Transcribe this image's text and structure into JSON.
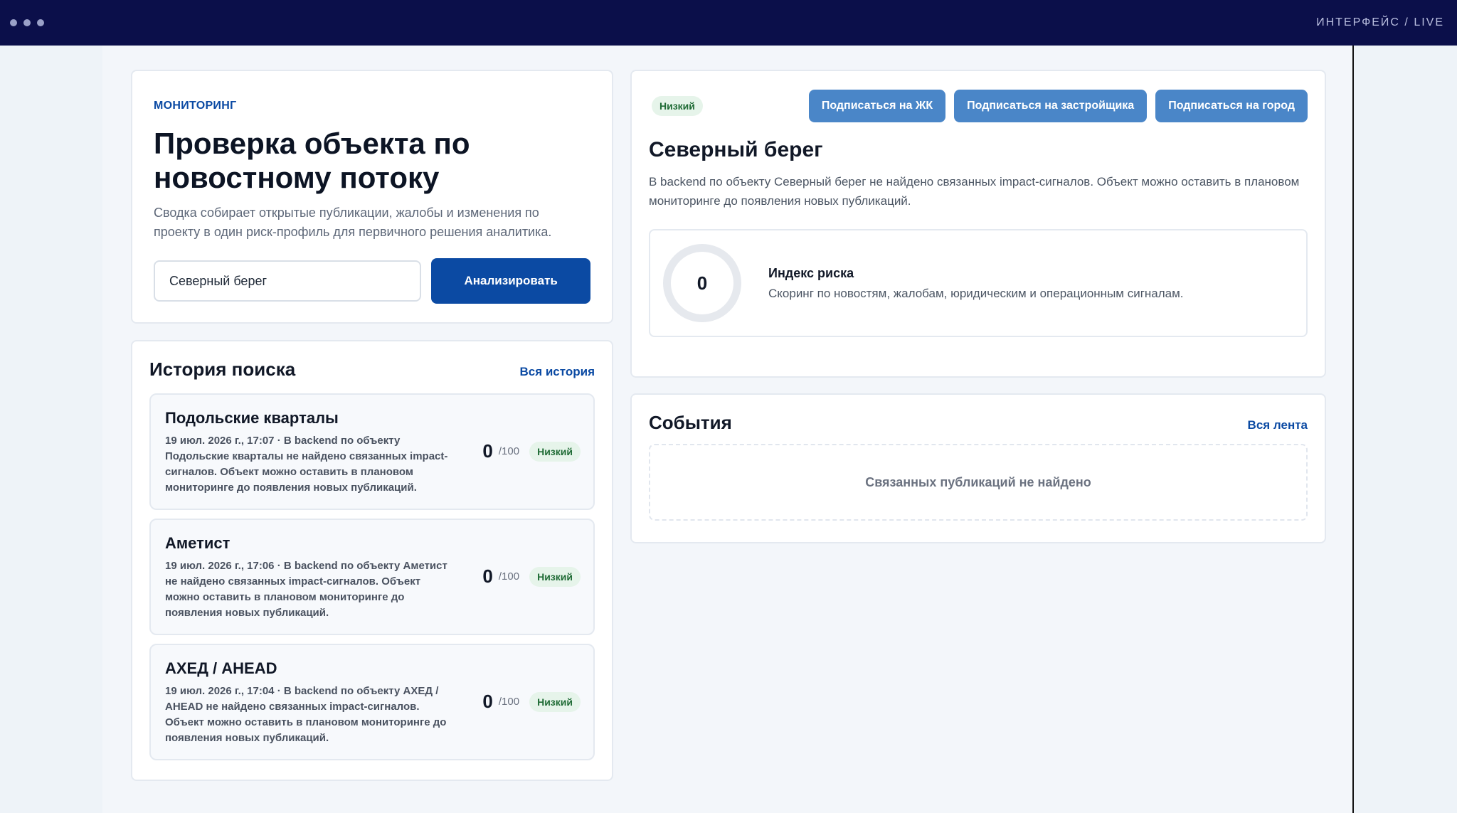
{
  "window": {
    "brand": "ИНТЕРФЕЙС / LIVE"
  },
  "monitor": {
    "kicker": "МОНИТОРИНГ",
    "title": "Проверка объекта по новостному потоку",
    "lead": "Сводка собирает открытые публикации, жалобы и изменения по проекту в один риск-профиль для первичного решения аналитика.",
    "search_value": "Северный берег",
    "analyze_label": "Анализировать"
  },
  "history": {
    "title": "История поиска",
    "all_link": "Вся история",
    "items": [
      {
        "title": "Подольские кварталы",
        "desc": "19 июл. 2026 г., 17:07 · В backend по объекту Подольские кварталы не найдено связанных impact-сигналов. Объект можно оставить в плановом мониторинге до появления новых публикаций.",
        "score": "0",
        "of": "/100",
        "badge": "Низкий"
      },
      {
        "title": "Аметист",
        "desc": "19 июл. 2026 г., 17:06 · В backend по объекту Аметист не найдено связанных impact-сигналов. Объект можно оставить в плановом мониторинге до появления новых публикаций.",
        "score": "0",
        "of": "/100",
        "badge": "Низкий"
      },
      {
        "title": "АХЕД / AHEAD",
        "desc": "19 июл. 2026 г., 17:04 · В backend по объекту АХЕД / AHEAD не найдено связанных impact-сигналов. Объект можно оставить в плановом мониторинге до появления новых публикаций.",
        "score": "0",
        "of": "/100",
        "badge": "Низкий"
      }
    ]
  },
  "object": {
    "badge": "Низкий",
    "subscribe_complex": "Подписаться на ЖК",
    "subscribe_developer": "Подписаться на застройщика",
    "subscribe_city": "Подписаться на город",
    "title": "Северный берег",
    "desc": "В backend по объекту Северный берег не найдено связанных impact-сигналов. Объект можно оставить в плановом мониторинге до появления новых публикаций.",
    "risk_value": "0",
    "risk_label": "Индекс риска",
    "risk_sub": "Скоринг по новостям, жалобам, юридическим и операционным сигналам."
  },
  "events": {
    "title": "События",
    "all_link": "Вся лента",
    "empty": "Связанных публикаций не найдено"
  },
  "colors": {
    "topbar": "#0b0f4a",
    "primary": "#0b4aa3",
    "secondary_button": "#4a86c8",
    "badge_bg": "#e6f4ea",
    "badge_text": "#1f6b35"
  }
}
